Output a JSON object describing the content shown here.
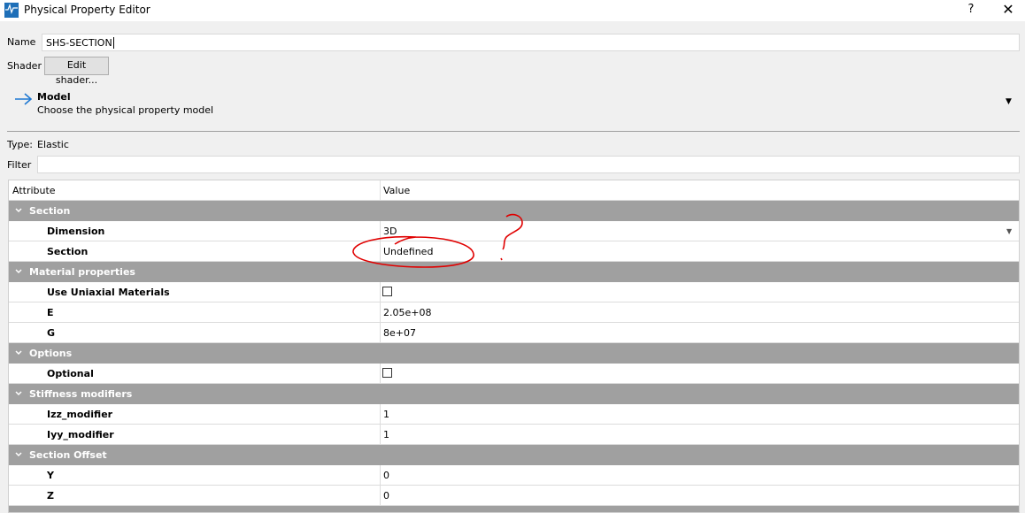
{
  "window": {
    "title": "Physical Property Editor",
    "help_label": "?",
    "close_label": "✕"
  },
  "name_field": {
    "label": "Name",
    "value": "SHS-SECTION"
  },
  "shader": {
    "label": "Shader",
    "button_label": "Edit shader..."
  },
  "model": {
    "title": "Model",
    "subtitle": "Choose the physical property model"
  },
  "type_line": {
    "label": "Type:",
    "value": "Elastic"
  },
  "filter": {
    "label": "Filter",
    "value": ""
  },
  "grid": {
    "headers": [
      "Attribute",
      "Value"
    ],
    "groups": [
      {
        "label": "Section",
        "items": [
          {
            "label": "Dimension",
            "value": "3D",
            "kind": "dropdown"
          },
          {
            "label": "Section",
            "value": "Undefined",
            "kind": "text"
          }
        ]
      },
      {
        "label": "Material properties",
        "items": [
          {
            "label": "Use Uniaxial Materials",
            "value": "",
            "kind": "checkbox",
            "checked": false
          },
          {
            "label": "E",
            "value": "2.05e+08",
            "kind": "text"
          },
          {
            "label": "G",
            "value": "8e+07",
            "kind": "text"
          }
        ]
      },
      {
        "label": "Options",
        "items": [
          {
            "label": "Optional",
            "value": "",
            "kind": "checkbox",
            "checked": false
          }
        ]
      },
      {
        "label": "Stiffness modifiers",
        "items": [
          {
            "label": "Izz_modifier",
            "value": "1",
            "kind": "text"
          },
          {
            "label": "Iyy_modifier",
            "value": "1",
            "kind": "text"
          }
        ]
      },
      {
        "label": "Section Offset",
        "items": [
          {
            "label": "Y",
            "value": "0",
            "kind": "text"
          },
          {
            "label": "Z",
            "value": "0",
            "kind": "text"
          }
        ]
      }
    ]
  },
  "colors": {
    "group_row": "#a0a0a0",
    "annotation": "#e00000",
    "accent_arrow": "#1e78d2"
  },
  "icons": {
    "app": "app-logo-icon",
    "model_arrow": "arrow-right-icon",
    "group_toggle": "chevron-down-icon"
  }
}
